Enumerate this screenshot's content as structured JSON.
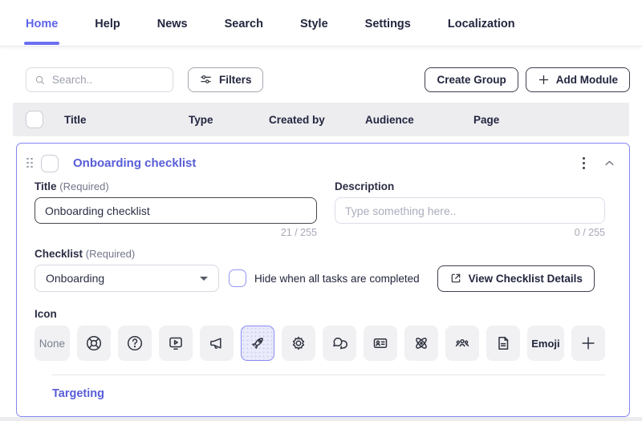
{
  "nav": {
    "items": [
      {
        "label": "Home",
        "active": true
      },
      {
        "label": "Help",
        "active": false
      },
      {
        "label": "News",
        "active": false
      },
      {
        "label": "Search",
        "active": false
      },
      {
        "label": "Style",
        "active": false
      },
      {
        "label": "Settings",
        "active": false
      },
      {
        "label": "Localization",
        "active": false
      }
    ]
  },
  "toolbar": {
    "search_placeholder": "Search..",
    "filters_label": "Filters",
    "create_group_label": "Create Group",
    "add_module_label": "Add Module"
  },
  "table": {
    "headers": [
      "Title",
      "Type",
      "Created by",
      "Audience",
      "Page"
    ]
  },
  "module_card": {
    "title": "Onboarding checklist",
    "form": {
      "title_field": {
        "label": "Title",
        "required_hint": "(Required)",
        "value": "Onboarding checklist",
        "counter": "21 / 255"
      },
      "description_field": {
        "label": "Description",
        "placeholder": "Type something here..",
        "counter": "0 / 255"
      },
      "checklist_field": {
        "label": "Checklist",
        "required_hint": "(Required)",
        "selected_option": "Onboarding"
      },
      "hide_checkbox_label": "Hide when all tasks are completed",
      "view_details_label": "View Checklist Details",
      "icon_field": {
        "label": "Icon",
        "none_label": "None",
        "emoji_label": "Emoji",
        "selected_icon": "rocket",
        "icon_names": [
          "lifebuoy",
          "question",
          "video",
          "megaphone",
          "rocket",
          "gear",
          "chat",
          "id-card",
          "atom",
          "team",
          "document"
        ]
      }
    },
    "footer_link": "Targeting"
  },
  "colors": {
    "accent_purple": "#5e63e9",
    "card_border_purple": "#8487f1",
    "selected_icon_bg": "#ebecfb",
    "table_header_bg": "#ededf0",
    "icon_button_bg": "#f1f1f4",
    "muted_text": "#a8aab6"
  }
}
